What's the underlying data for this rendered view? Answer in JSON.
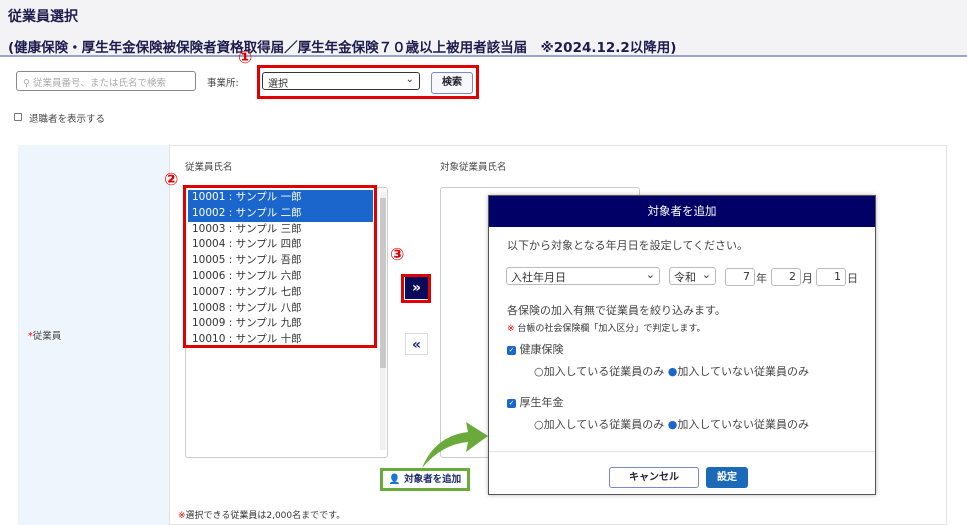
{
  "header": {
    "title": "従業員選択",
    "subtitle": "(健康保険・厚生年金保険被保険者資格取得届／厚生年金保険７０歳以上被用者該当届　※2024.12.2以降用)"
  },
  "search": {
    "placeholder": "従業員番号、または氏名で検索",
    "office_label": "事業所:",
    "office_value": "選択",
    "search_button": "検索"
  },
  "show_retired": "退職者を表示する",
  "markers": {
    "one": "①",
    "two": "②",
    "three": "③"
  },
  "form": {
    "employee_label": "従業員",
    "required_mark": "*",
    "list_header": "従業員氏名",
    "target_header": "対象従業員氏名",
    "employees": [
      {
        "label": "10001 : サンプル 一郎",
        "selected": true
      },
      {
        "label": "10002 : サンプル 二郎",
        "selected": true
      },
      {
        "label": "10003 : サンプル 三郎",
        "selected": false
      },
      {
        "label": "10004 : サンプル 四郎",
        "selected": false
      },
      {
        "label": "10005 : サンプル 吾郎",
        "selected": false
      },
      {
        "label": "10006 : サンプル 六郎",
        "selected": false
      },
      {
        "label": "10007 : サンプル 七郎",
        "selected": false
      },
      {
        "label": "10008 : サンプル 八郎",
        "selected": false
      },
      {
        "label": "10009 : サンプル 九郎",
        "selected": false
      },
      {
        "label": "10010 : サンプル 十郎",
        "selected": false
      }
    ],
    "add_all": "»",
    "remove_all": "«",
    "add_target_button": "対象者を追加",
    "note_mark": "※",
    "note": "選択できる従業員は2,000名までです。"
  },
  "modal": {
    "title": "対象者を追加",
    "instruction": "以下から対象となる年月日を設定してください。",
    "date_type": "入社年月日",
    "era": "令和",
    "year": "7",
    "year_unit": "年",
    "month": "2",
    "month_unit": "月",
    "day": "1",
    "day_unit": "日",
    "filter_text": "各保険の加入有無で従業員を絞り込みます。",
    "note_mark": "※",
    "note": "台帳の社会保険欄「加入区分」で判定します。",
    "health": {
      "label": "健康保険",
      "opt1": "加入している従業員のみ",
      "opt2": "加入していない従業員のみ"
    },
    "pension": {
      "label": "厚生年金",
      "opt1": "加入している従業員のみ",
      "opt2": "加入していない従業員のみ"
    },
    "cancel": "キャンセル",
    "ok": "設定"
  }
}
